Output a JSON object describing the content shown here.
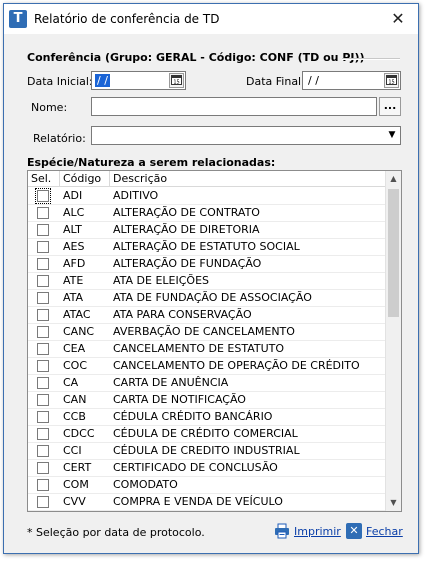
{
  "window": {
    "title": "Relatório de conferência de TD",
    "close_glyph": "✕"
  },
  "filters": {
    "group_title": "Conferência (Grupo: GERAL - Código: CONF (TD ou PJ))",
    "start_date_label": "Data Inicial:",
    "start_date_value": "/ /",
    "end_date_label": "Data Final:",
    "end_date_value": "/ /",
    "name_label": "Nome:",
    "name_value": "",
    "browse_label": "...",
    "report_label": "Relatório:",
    "report_value": ""
  },
  "grid": {
    "section_title": "Espécie/Natureza a serem relacionadas:",
    "columns": [
      "Sel.",
      "Código",
      "Descrição"
    ],
    "rows": [
      {
        "code": "ADI",
        "desc": "ADITIVO"
      },
      {
        "code": "ALC",
        "desc": "ALTERAÇÃO DE CONTRATO"
      },
      {
        "code": "ALT",
        "desc": "ALTERAÇÃO DE DIRETORIA"
      },
      {
        "code": "AES",
        "desc": "ALTERAÇÃO DE ESTATUTO SOCIAL"
      },
      {
        "code": "AFD",
        "desc": "ALTERAÇÃO DE FUNDAÇÃO"
      },
      {
        "code": "ATE",
        "desc": "ATA DE ELEIÇÕES"
      },
      {
        "code": "ATA",
        "desc": "ATA DE FUNDAÇÃO DE ASSOCIAÇÃO"
      },
      {
        "code": "ATAC",
        "desc": "ATA PARA CONSERVAÇÃO"
      },
      {
        "code": "CANC",
        "desc": "AVERBAÇÃO DE CANCELAMENTO"
      },
      {
        "code": "CEA",
        "desc": "CANCELAMENTO DE ESTATUTO"
      },
      {
        "code": "COC",
        "desc": "CANCELAMENTO DE OPERAÇÃO DE CRÉDITO"
      },
      {
        "code": "CA",
        "desc": "CARTA DE ANUÊNCIA"
      },
      {
        "code": "CAN",
        "desc": "CARTA DE NOTIFICAÇÃO"
      },
      {
        "code": "CCB",
        "desc": "CÉDULA CRÉDITO BANCÁRIO"
      },
      {
        "code": "CDCC",
        "desc": "CÉDULA DE CRÉDITO COMERCIAL"
      },
      {
        "code": "CCI",
        "desc": "CÉDULA DE CREDITO INDUSTRIAL"
      },
      {
        "code": "CERT",
        "desc": "CERTIFICADO DE CONCLUSÃO"
      },
      {
        "code": "COM",
        "desc": "COMODATO"
      },
      {
        "code": "CVV",
        "desc": "COMPRA E VENDA DE VEÍCULO"
      }
    ]
  },
  "footer": {
    "note": "* Seleção por data de protocolo.",
    "print_label": "Imprimir",
    "close_label": "Fechar"
  },
  "colors": {
    "accent": "#1a64d6",
    "link": "#0b3fa8",
    "window_border": "#3c6fb0"
  },
  "icons": {
    "app": "app-logo-icon",
    "calendar": "calendar-icon",
    "print": "printer-icon",
    "close": "close-x-icon"
  }
}
